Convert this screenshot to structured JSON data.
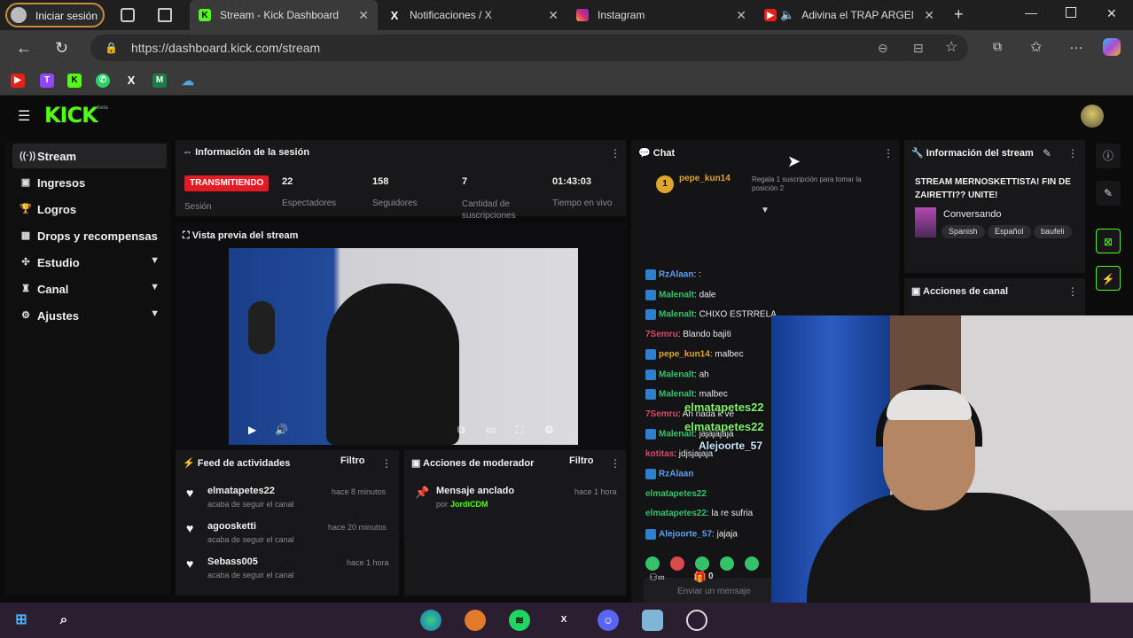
{
  "browser": {
    "profile_label": "Iniciar sesión",
    "tabs": [
      {
        "title": "Stream - Kick Dashboard",
        "active": true
      },
      {
        "title": "Notificaciones / X",
        "active": false
      },
      {
        "title": "Instagram",
        "active": false
      },
      {
        "title": "Adivina el TRAP ARGEN",
        "active": false
      }
    ],
    "url": "https://dashboard.kick.com/stream"
  },
  "kick": {
    "logo": "KICK",
    "logo_sup": "beta",
    "sidebar": [
      {
        "label": "Stream",
        "icon": "broadcast-icon",
        "active": true
      },
      {
        "label": "Ingresos",
        "icon": "income-icon"
      },
      {
        "label": "Logros",
        "icon": "trophy-icon"
      },
      {
        "label": "Drops y recompensas",
        "icon": "drops-icon"
      },
      {
        "label": "Estudio",
        "icon": "studio-icon",
        "expand": true
      },
      {
        "label": "Canal",
        "icon": "channel-icon",
        "expand": true
      },
      {
        "label": "Ajustes",
        "icon": "gear-icon",
        "expand": true
      }
    ],
    "session": {
      "title": "Información de la sesión",
      "status": "TRANSMITIENDO",
      "status_sub": "Sesión",
      "viewers": "22",
      "viewers_label": "Espectadores",
      "followers": "158",
      "followers_label": "Seguidores",
      "subs": "7",
      "subs_label": "Cantidad de suscripciones",
      "uptime": "01:43:03",
      "uptime_label": "Tiempo en vivo"
    },
    "preview": {
      "title": "Vista previa del stream"
    },
    "chat": {
      "title": "Chat",
      "pinned_user": "pepe_kun14",
      "pinned_count": "1",
      "pinned_text": "Regala 1 suscripción para tomar la posición 2",
      "messages": [
        {
          "user": "RzAlaan",
          "text": ":",
          "color": "#5aa0f0",
          "badge": true
        },
        {
          "user": "Malenalt",
          "text": "dale",
          "color": "#35c26b",
          "badge": true
        },
        {
          "user": "Malenalt",
          "text": "CHIXO ESTRRELA",
          "color": "#35c26b",
          "badge": true
        },
        {
          "user": "7Semru",
          "text": "Blando bajiti",
          "color": "#d94a6a",
          "badge": false
        },
        {
          "user": "pepe_kun14",
          "text": "malbec",
          "color": "#e0a52c",
          "badge": true
        },
        {
          "user": "Malenalt",
          "text": "ah",
          "color": "#35c26b",
          "badge": true
        },
        {
          "user": "Malenalt",
          "text": "malbec",
          "color": "#35c26b",
          "badge": true
        },
        {
          "user": "7Semru",
          "text": "Ah nada k ve",
          "color": "#d94a6a",
          "badge": false
        },
        {
          "user": "Malenalt",
          "text": "jajajajaja",
          "color": "#35c26b",
          "badge": true
        },
        {
          "user": "kotitas",
          "text": "jdjsjajaja",
          "color": "#d94a6a",
          "badge": false
        },
        {
          "user": "RzAlaan",
          "text": "",
          "color": "#5aa0f0",
          "badge": true
        },
        {
          "user": "elmatapetes22",
          "text": "",
          "color": "#35c26b",
          "badge": false
        },
        {
          "user": "elmatapetes22",
          "text": "la re sufria",
          "color": "#35c26b",
          "badge": false
        },
        {
          "user": "Alejoorte_57",
          "text": "jajaja",
          "color": "#5aa0f0",
          "badge": true
        }
      ],
      "overlay_names": [
        "elmatapetes22",
        "elmatapetes22",
        "Alejoorte_57"
      ],
      "input_placeholder": "Enviar un mensaje",
      "count": "0"
    },
    "stream_info": {
      "title": "Información del stream",
      "stream_title": "STREAM MERNOSKETTISTA! FIN DE ZAIRETTI?? UNITE!",
      "category": "Conversando",
      "tags": [
        "Spanish",
        "Español",
        "baufeli"
      ]
    },
    "channel_actions": {
      "title": "Acciones de canal"
    },
    "feed": {
      "title": "Feed de actividades",
      "filter": "Filtro",
      "items": [
        {
          "user": "elmatapetes22",
          "action": "acaba de seguir el canal",
          "time": "hace 8 minutos"
        },
        {
          "user": "agoosketti",
          "action": "acaba de seguir el canal",
          "time": "hace 20 minutos"
        },
        {
          "user": "Sebass005",
          "action": "acaba de seguir el canal",
          "time": "hace 1 hora"
        }
      ]
    },
    "mod": {
      "title": "Acciones de moderador",
      "filter": "Filtro",
      "pinned_label": "Mensaje anclado",
      "pinned_by_prefix": "por",
      "pinned_by": "JordiCDM",
      "time": "hace 1 hora"
    }
  },
  "colors": {
    "kick_green": "#53fc18",
    "live_red": "#e41b23"
  }
}
